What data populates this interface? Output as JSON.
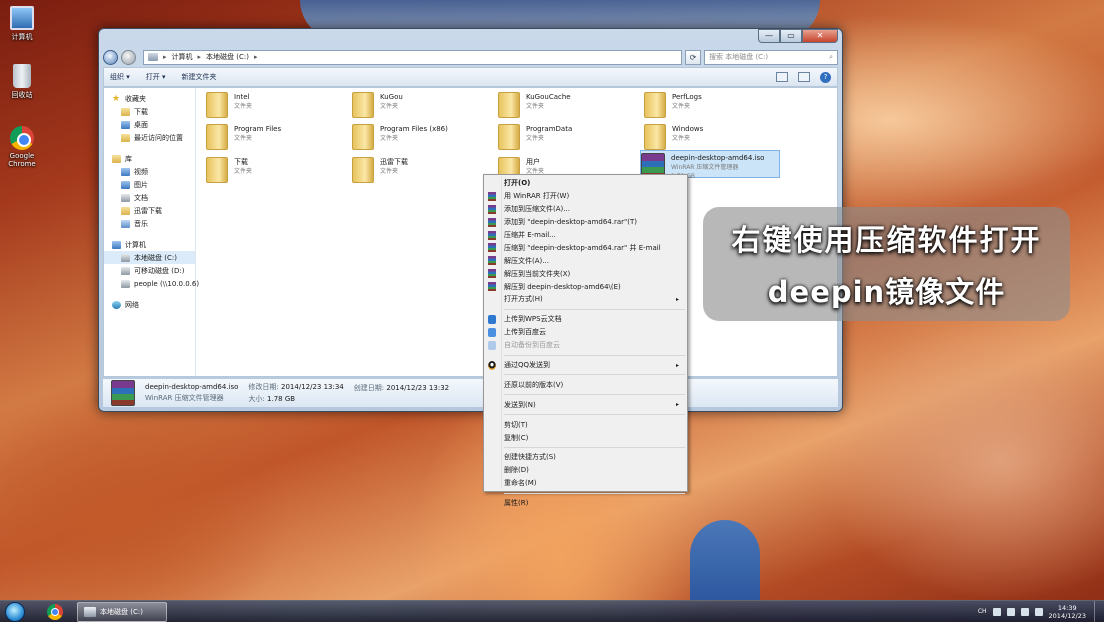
{
  "desktop": {
    "icons": [
      {
        "label": "计算机"
      },
      {
        "label": "回收站"
      },
      {
        "label": "Google\nChrome",
        "line1": "Google",
        "line2": "Chrome"
      }
    ]
  },
  "window": {
    "caption_buttons": [
      "—",
      "▭",
      "✕"
    ],
    "breadcrumb": [
      "计算机",
      "本地磁盘 (C:)"
    ],
    "search_placeholder": "搜索 本地磁盘 (C:)",
    "toolbar": {
      "organize": "组织 ▾",
      "open": "打开 ▾",
      "new_folder": "新建文件夹"
    },
    "nav": {
      "favorites": {
        "label": "收藏夹",
        "items": [
          "下载",
          "桌面",
          "最近访问的位置"
        ]
      },
      "libraries": {
        "label": "库",
        "items": [
          "视频",
          "图片",
          "文档",
          "迅雷下载",
          "音乐"
        ]
      },
      "computer": {
        "label": "计算机",
        "items": [
          "本地磁盘 (C:)",
          "可移动磁盘 (D:)",
          "people (\\\\10.0.0.6)"
        ]
      },
      "network": {
        "label": "网络"
      }
    },
    "files": [
      {
        "name": "Intel",
        "type": "文件夹"
      },
      {
        "name": "KuGou",
        "type": "文件夹"
      },
      {
        "name": "KuGouCache",
        "type": "文件夹"
      },
      {
        "name": "PerfLogs",
        "type": "文件夹"
      },
      {
        "name": "Program Files",
        "type": "文件夹"
      },
      {
        "name": "Program Files (x86)",
        "type": "文件夹"
      },
      {
        "name": "ProgramData",
        "type": "文件夹"
      },
      {
        "name": "Windows",
        "type": "文件夹"
      },
      {
        "name": "下载",
        "type": "文件夹"
      },
      {
        "name": "迅雷下载",
        "type": "文件夹"
      },
      {
        "name": "用户",
        "type": "文件夹"
      },
      {
        "name": "deepin-desktop-amd64.iso",
        "type": "WinRAR 压缩文件管理器",
        "size": "1.78 GB"
      }
    ],
    "details": {
      "name": "deepin-desktop-amd64.iso",
      "type": "WinRAR 压缩文件管理器",
      "modified_label": "修改日期:",
      "modified": "2014/12/23 13:34",
      "created_label": "创建日期:",
      "created": "2014/12/23 13:32",
      "size_label": "大小:",
      "size": "1.78 GB"
    }
  },
  "context_menu": {
    "items": [
      {
        "label": "打开(O)",
        "bold": true
      },
      {
        "label": "用 WinRAR 打开(W)",
        "icon": "winrar-icon"
      },
      {
        "label": "添加到压缩文件(A)...",
        "icon": "winrar-icon"
      },
      {
        "label": "添加到 \"deepin-desktop-amd64.rar\"(T)",
        "icon": "winrar-icon"
      },
      {
        "label": "压缩并 E-mail...",
        "icon": "winrar-icon"
      },
      {
        "label": "压缩到 \"deepin-desktop-amd64.rar\" 并 E-mail",
        "icon": "winrar-icon"
      },
      {
        "label": "解压文件(A)...",
        "icon": "winrar-icon"
      },
      {
        "label": "解压到当前文件夹(X)",
        "icon": "winrar-icon"
      },
      {
        "label": "解压到 deepin-desktop-amd64\\(E)",
        "icon": "winrar-icon"
      },
      {
        "label": "打开方式(H)",
        "submenu": true
      },
      {
        "label": "上传到WPS云文档",
        "icon": "wps-icon"
      },
      {
        "label": "上传到百度云",
        "icon": "baidu-icon"
      },
      {
        "label": "自动备份到百度云",
        "icon": "baidu-icon",
        "disabled": true
      },
      {
        "label": "通过QQ发送到",
        "icon": "qq-icon",
        "submenu": true
      },
      {
        "label": "还原以前的版本(V)"
      },
      {
        "label": "发送到(N)",
        "submenu": true
      },
      {
        "label": "剪切(T)"
      },
      {
        "label": "复制(C)"
      },
      {
        "label": "创建快捷方式(S)"
      },
      {
        "label": "删除(D)"
      },
      {
        "label": "重命名(M)"
      },
      {
        "label": "属性(R)"
      }
    ],
    "submenu_arrow": "▸"
  },
  "caption": {
    "line1": "右键使用压缩软件打开",
    "line2": "deepin镜像文件"
  },
  "taskbar": {
    "task_label": "本地磁盘 (C:)",
    "tray_lang": "CH",
    "time": "14:39",
    "date": "2014/12/23"
  }
}
